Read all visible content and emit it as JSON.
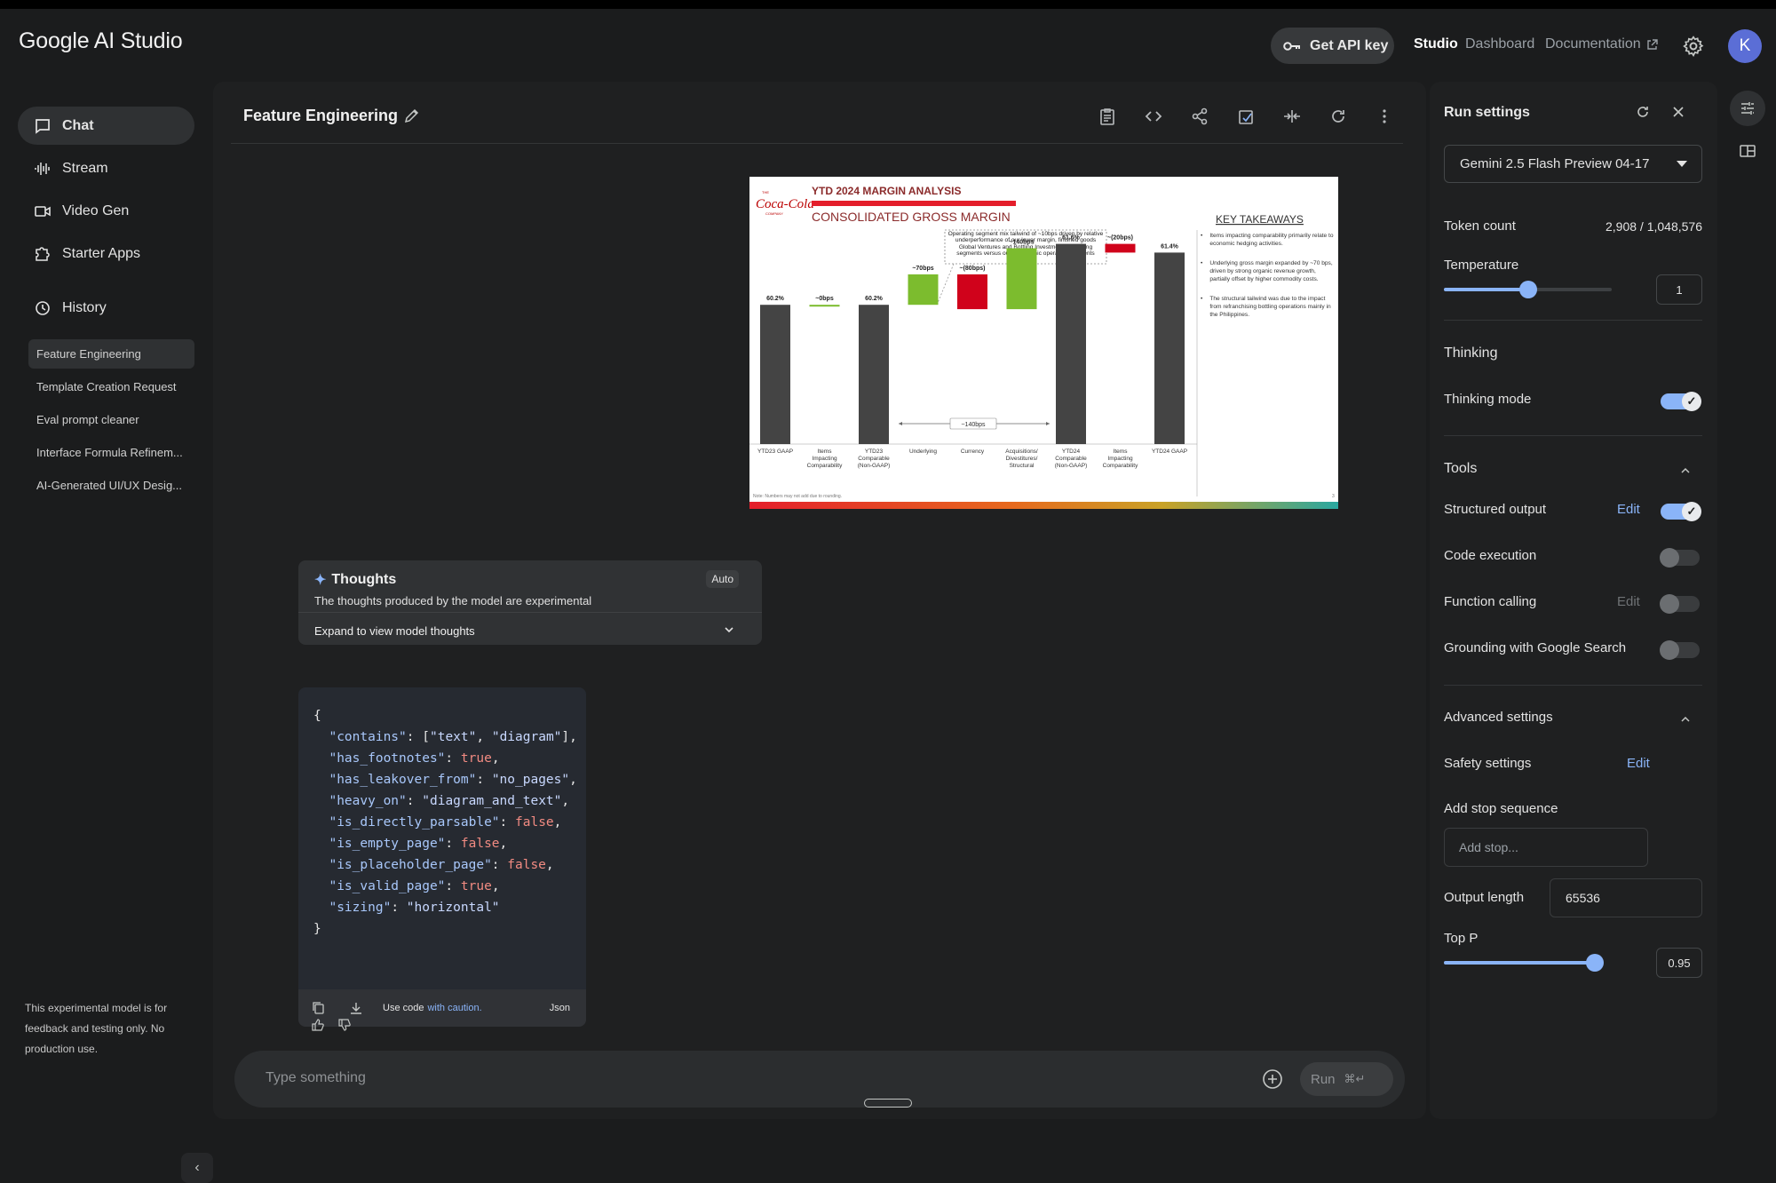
{
  "app": {
    "title": "Google AI Studio"
  },
  "topnav": {
    "api_key_label": "Get API key",
    "studio": "Studio",
    "dashboard": "Dashboard",
    "documentation": "Documentation",
    "avatar_initial": "K"
  },
  "sidebar": {
    "items": [
      {
        "label": "Chat",
        "icon": "chat-icon"
      },
      {
        "label": "Stream",
        "icon": "waveform-icon"
      },
      {
        "label": "Video Gen",
        "icon": "video-icon"
      },
      {
        "label": "Starter Apps",
        "icon": "puzzle-icon"
      }
    ],
    "history_label": "History",
    "history": [
      "Feature Engineering",
      "Template Creation Request",
      "Eval prompt cleaner",
      "Interface Formula Refinem...",
      "AI-Generated UI/UX Desig..."
    ],
    "note": "This experimental model is for feedback and testing only. No production use."
  },
  "chat": {
    "title": "Feature Engineering",
    "slide": {
      "company_top": "THE",
      "company_logo": "Coca-Cola",
      "company_bottom": "COMPANY",
      "header": "YTD 2024 MARGIN ANALYSIS",
      "subheader": "CONSOLIDATED GROSS MARGIN",
      "callout": "Operating segment mix tailwind of ~10bps driven by relative underperformance of our lower margin, finished goods Global Ventures and Bottling Investments operating segments versus our geographic operating segments",
      "bracket_label": "~140bps",
      "takeaways_title": "KEY TAKEAWAYS",
      "takeaways": [
        "Items impacting comparability primarily relate to economic hedging activities.",
        "Underlying gross margin expanded by ~70 bps, driven by strong organic revenue growth, partially offset by higher commodity costs.",
        "The structural tailwind was due to the impact from refranchising bottling operations mainly in the Philippines."
      ],
      "footnote": "Note: Numbers may not add due to rounding.",
      "page_number": "3"
    },
    "chart_data": {
      "type": "bar",
      "title": "CONSOLIDATED GROSS MARGIN",
      "categories": [
        "YTD23 GAAP",
        "Items Impacting Comparability",
        "YTD23 Comparable (Non-GAAP)",
        "Underlying",
        "Currency",
        "Acquisitions/ Divestitures/ Structural",
        "YTD24 Comparable (Non-GAAP)",
        "Items Impacting Comparability",
        "YTD24 GAAP"
      ],
      "data_labels": [
        "60.2%",
        "~0bps",
        "60.2%",
        "~70bps",
        "~(80bps)",
        "~140bps",
        "61.6%",
        "~(20bps)",
        "61.4%"
      ],
      "values": [
        60.2,
        0.0,
        60.2,
        0.7,
        -0.8,
        1.4,
        61.6,
        -0.2,
        61.4
      ],
      "colors": [
        "#444444",
        "#7cbc2e",
        "#444444",
        "#7cbc2e",
        "#d0021b",
        "#7cbc2e",
        "#444444",
        "#d0021b",
        "#444444"
      ],
      "ylim": [
        57,
        62
      ]
    },
    "thoughts": {
      "title": "Thoughts",
      "subtitle": "The thoughts produced by the model are experimental",
      "badge": "Auto",
      "expand": "Expand to view model thoughts"
    },
    "code": {
      "footer_use": "Use code",
      "footer_caution": "with caution.",
      "footer_period": ".",
      "lang": "Json"
    },
    "composer_placeholder": "Type something",
    "run_label": "Run",
    "run_shortcut": "⌘↵"
  },
  "run_settings": {
    "title": "Run settings",
    "model": "Gemini 2.5 Flash Preview 04-17",
    "token_label": "Token count",
    "token_value": "2,908 / 1,048,576",
    "temperature_label": "Temperature",
    "temperature_value": "1",
    "temperature_fraction": 0.5,
    "thinking_label": "Thinking",
    "thinking_mode_label": "Thinking mode",
    "tools_label": "Tools",
    "structured_output": "Structured output",
    "code_execution": "Code execution",
    "function_calling": "Function calling",
    "grounding": "Grounding with Google Search",
    "edit": "Edit",
    "advanced_label": "Advanced settings",
    "safety_label": "Safety settings",
    "stop_label": "Add stop sequence",
    "stop_placeholder": "Add stop...",
    "output_length_label": "Output length",
    "output_length_value": "65536",
    "top_p_label": "Top P",
    "top_p_value": "0.95",
    "top_p_fraction": 0.95
  },
  "colors": {
    "accent": "#8ab4f8",
    "background": "#1b1c1d",
    "panel": "#1f2021",
    "slide_red": "#e41e2b"
  }
}
